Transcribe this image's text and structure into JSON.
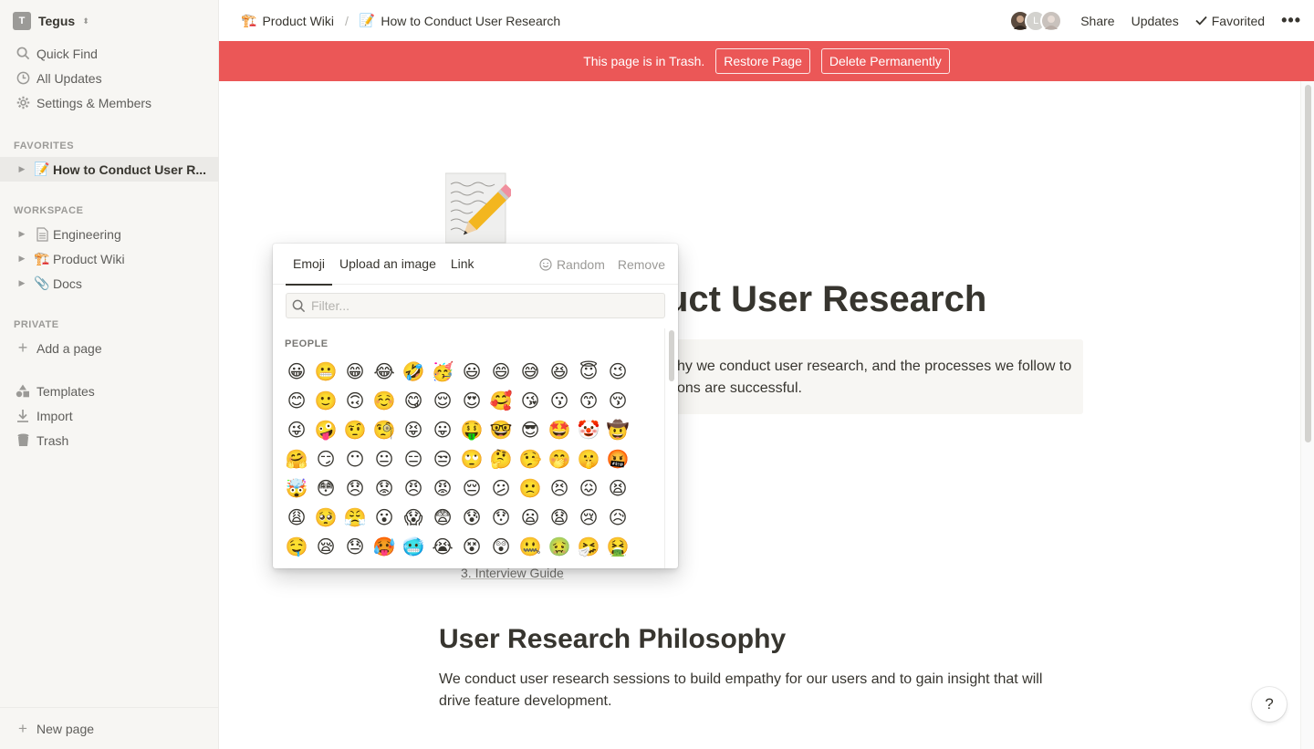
{
  "workspace": {
    "badge": "T",
    "name": "Tegus"
  },
  "sidebar": {
    "top_items": [
      {
        "label": "Quick Find",
        "icon": "search-icon"
      },
      {
        "label": "All Updates",
        "icon": "clock-icon"
      },
      {
        "label": "Settings & Members",
        "icon": "gear-icon"
      }
    ],
    "favorites_header": "FAVORITES",
    "favorites": [
      {
        "label": "How to Conduct User R...",
        "icon": "memo-icon"
      }
    ],
    "workspace_header": "WORKSPACE",
    "workspace_items": [
      {
        "label": "Engineering",
        "icon": "page-icon"
      },
      {
        "label": "Product Wiki",
        "icon": "construction-sign-icon"
      },
      {
        "label": "Docs",
        "icon": "paperclip-icon"
      }
    ],
    "private_header": "PRIVATE",
    "add_page": "Add a page",
    "bottom_items": [
      {
        "label": "Templates",
        "icon": "shapes-icon"
      },
      {
        "label": "Import",
        "icon": "download-icon"
      },
      {
        "label": "Trash",
        "icon": "trash-icon"
      }
    ],
    "new_page": "New page"
  },
  "topbar": {
    "breadcrumbs": [
      {
        "label": "Product Wiki",
        "icon": "construction-sign-icon"
      },
      {
        "label": "How to Conduct User Research",
        "icon": "memo-icon"
      }
    ],
    "separator": "/",
    "avatar_initial": "L",
    "share": "Share",
    "updates": "Updates",
    "favorited": "Favorited",
    "more": "•••"
  },
  "banner": {
    "message": "This page is in Trash.",
    "restore": "Restore Page",
    "delete": "Delete Permanently"
  },
  "page": {
    "title_visible": "uct User Research",
    "callout_text": "hy we conduct user research, and the processes we follow to ons are successful.",
    "toc_item": "3. Interview Guide",
    "heading": "User Research Philosophy",
    "paragraph": "We conduct user research sessions to build empathy for our users and to gain insight that will drive feature development.",
    "help": "?"
  },
  "emoji_picker": {
    "tabs": [
      "Emoji",
      "Upload an image",
      "Link"
    ],
    "selected_tab": "Emoji",
    "random": "Random",
    "remove": "Remove",
    "search_placeholder": "Filter...",
    "search_value": "",
    "category": "PEOPLE",
    "emojis": [
      "😀",
      "😬",
      "😁",
      "😂",
      "🤣",
      "🥳",
      "😃",
      "😄",
      "😅",
      "😆",
      "😇",
      "😉",
      "😊",
      "🙂",
      "🙃",
      "☺️",
      "😋",
      "😌",
      "😍",
      "🥰",
      "😘",
      "😗",
      "😙",
      "😚",
      "😜",
      "🤪",
      "🤨",
      "🧐",
      "😝",
      "😛",
      "🤑",
      "🤓",
      "😎",
      "🤩",
      "🤡",
      "🤠",
      "🤗",
      "😏",
      "😶",
      "😐",
      "😑",
      "😒",
      "🙄",
      "🤔",
      "🤥",
      "🤭",
      "🤫",
      "🤬",
      "🤯",
      "😳",
      "😞",
      "😟",
      "😠",
      "😡",
      "😔",
      "😕",
      "🙁",
      "😣",
      "😖",
      "😫",
      "😩",
      "🥺",
      "😤",
      "😮",
      "😱",
      "😨",
      "😰",
      "😯",
      "😦",
      "😧",
      "😢",
      "😥",
      "🤤",
      "😪",
      "😓",
      "🥵",
      "🥶",
      "😭",
      "😵",
      "😲",
      "🤐",
      "🤢",
      "🤧",
      "🤮"
    ]
  },
  "colors": {
    "banner": "#eb5757",
    "sidebar_bg": "#f7f6f3",
    "text": "#37352f",
    "muted": "#9b9a97"
  }
}
